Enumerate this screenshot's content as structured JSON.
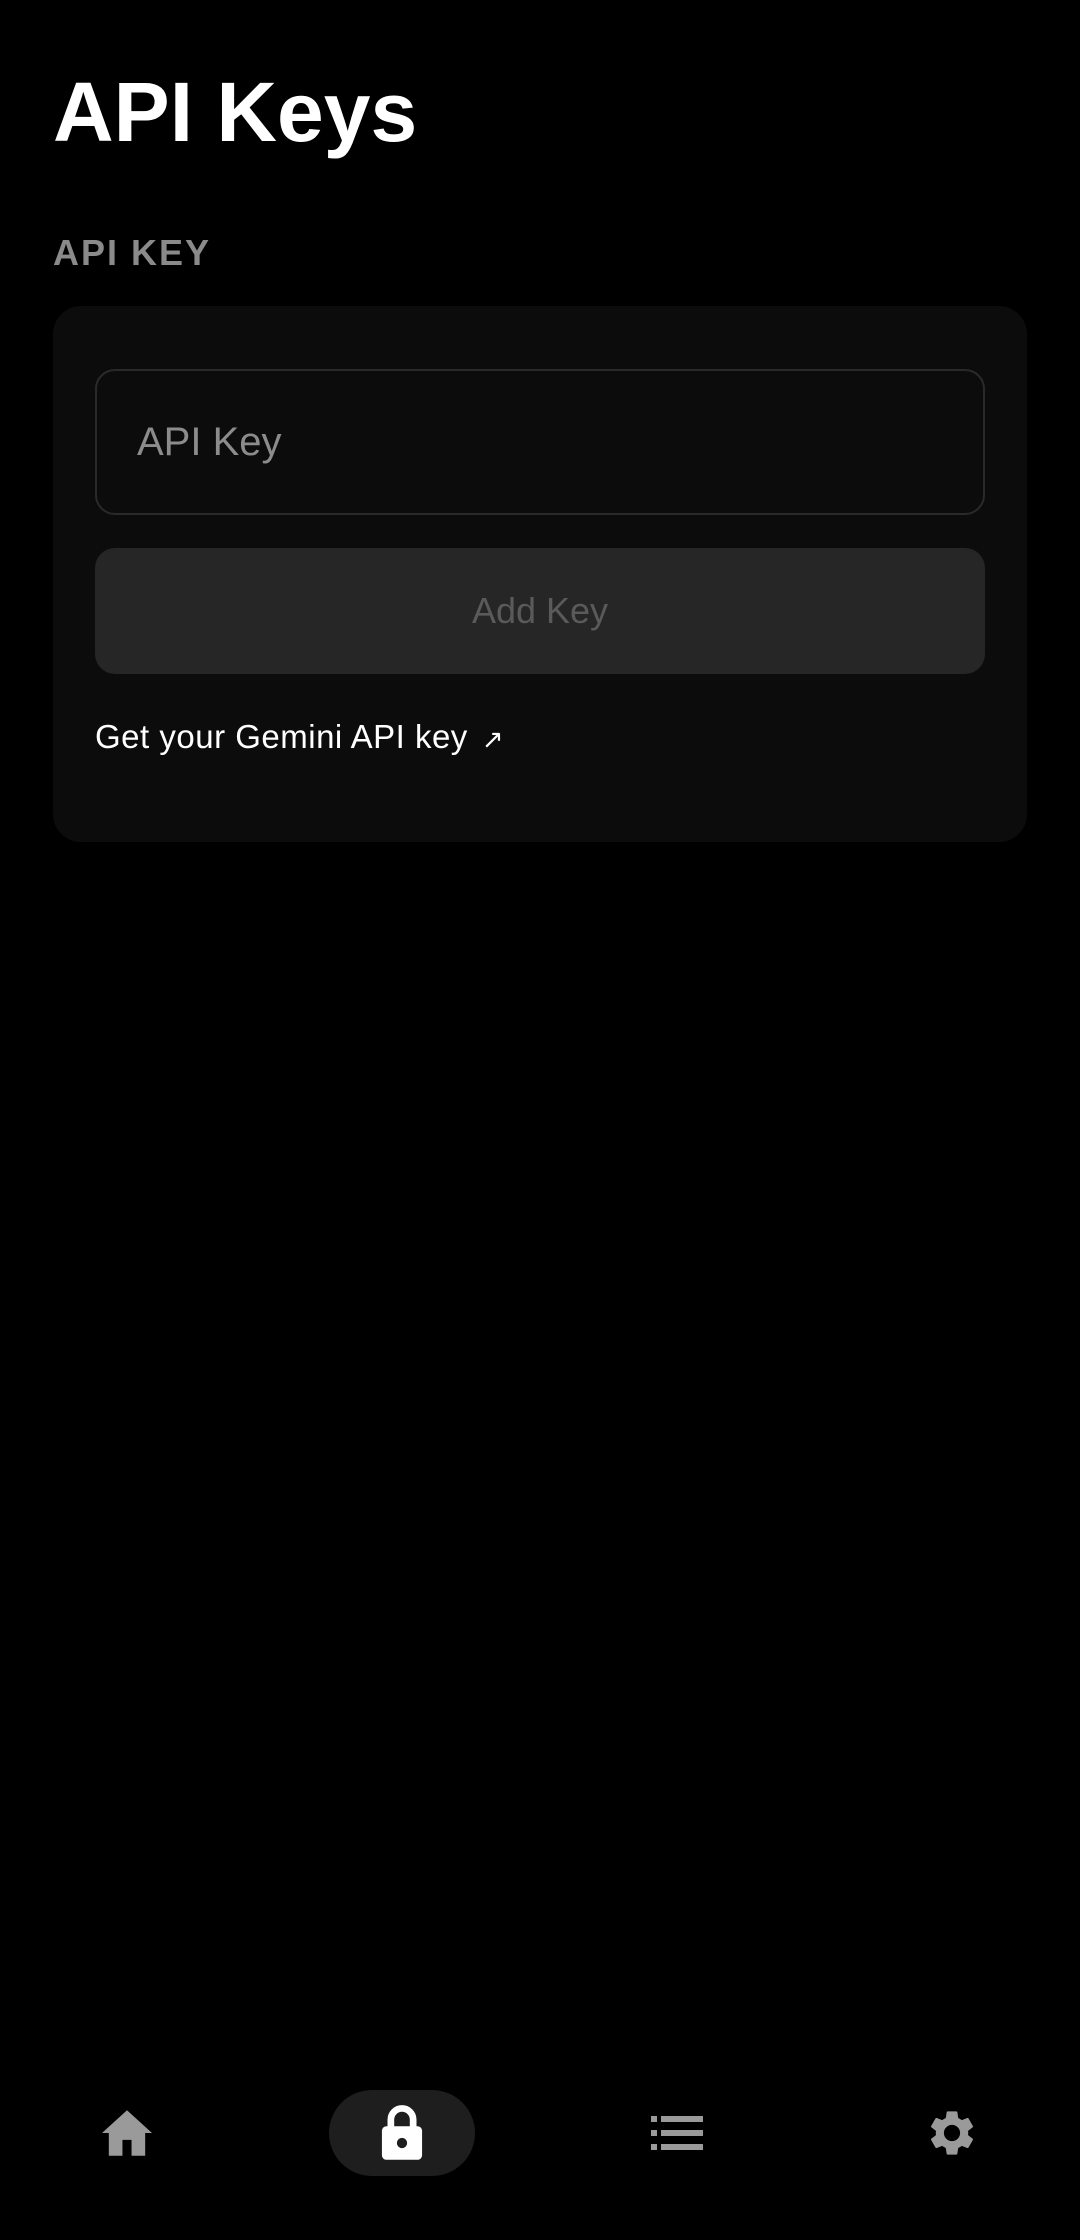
{
  "page": {
    "title": "API Keys"
  },
  "section": {
    "label": "API KEY"
  },
  "form": {
    "input_placeholder": "API Key",
    "input_value": "",
    "add_button_label": "Add Key",
    "link_text": "Get your Gemini API key",
    "link_arrow": "↗"
  },
  "bottom_nav": {
    "items": [
      {
        "icon": "home-icon",
        "active": false
      },
      {
        "icon": "lock-icon",
        "active": true
      },
      {
        "icon": "list-icon",
        "active": false
      },
      {
        "icon": "gear-icon",
        "active": false
      }
    ]
  },
  "colors": {
    "background": "#000000",
    "card": "#0c0c0c",
    "button_disabled": "#262626",
    "active_nav_pill": "#1e1e1e",
    "inactive_icon": "#9a9a9a",
    "active_icon": "#ffffff"
  }
}
